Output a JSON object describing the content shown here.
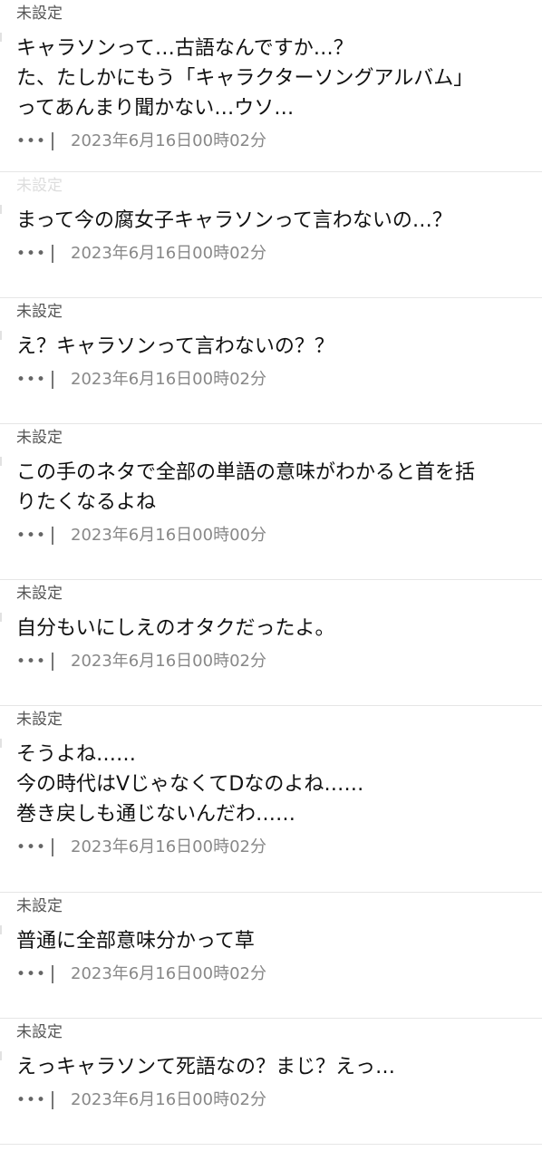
{
  "comments": [
    {
      "author": "未設定",
      "text": "キャラソンって…古語なんですか…？\nた、たしかにもう「キャラクターソングアルバム」\nってあんまり聞かない…ウソ…",
      "more": "•••",
      "timestamp": "2023年6月16日00時02分"
    },
    {
      "author": "未設定",
      "text": "まって今の腐女子キャラソンって言わないの…？",
      "more": "•••",
      "timestamp": "2023年6月16日00時02分"
    },
    {
      "author": "未設定",
      "text": "え？キャラソンって言わないの？？",
      "more": "•••",
      "timestamp": "2023年6月16日00時02分"
    },
    {
      "author": "未設定",
      "text": "この手のネタで全部の単語の意味がわかると首を括\nりたくなるよね",
      "more": "•••",
      "timestamp": "2023年6月16日00時00分"
    },
    {
      "author": "未設定",
      "text": "自分もいにしえのオタクだったよ。",
      "more": "•••",
      "timestamp": "2023年6月16日00時02分"
    },
    {
      "author": "未設定",
      "text": "そうよね……\n今の時代はVじゃなくてDなのよね……\n巻き戻しも通じないんだわ……",
      "more": "•••",
      "timestamp": "2023年6月16日00時02分"
    },
    {
      "author": "未設定",
      "text": "普通に全部意味分かって草",
      "more": "•••",
      "timestamp": "2023年6月16日00時02分"
    },
    {
      "author": "未設定",
      "text": "えっキャラソンて死語なの？まじ？えっ…",
      "more": "•••",
      "timestamp": "2023年6月16日00時02分"
    }
  ]
}
